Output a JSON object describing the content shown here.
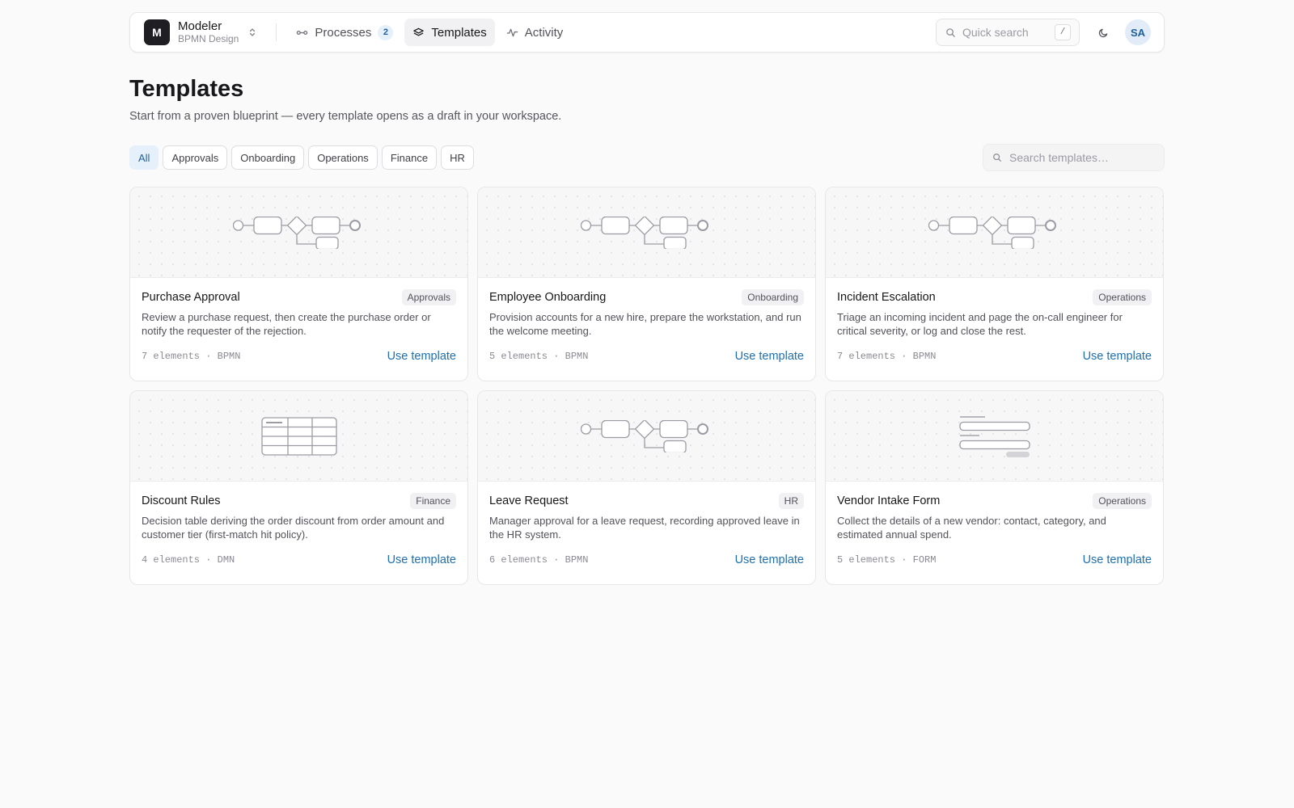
{
  "header": {
    "brand_initial": "M",
    "brand_name": "Modeler",
    "brand_sub": "BPMN Design",
    "nav": [
      {
        "label": "Processes",
        "icon": "flow-icon",
        "badge": "2"
      },
      {
        "label": "Templates",
        "icon": "layers-icon",
        "active": true
      },
      {
        "label": "Activity",
        "icon": "pulse-icon"
      }
    ],
    "search_placeholder": "Quick search",
    "search_shortcut": "/",
    "avatar": "SA"
  },
  "page": {
    "title": "Templates",
    "subtitle": "Start from a proven blueprint — every template opens as a draft in your workspace."
  },
  "filters": [
    {
      "label": "All",
      "active": true
    },
    {
      "label": "Approvals"
    },
    {
      "label": "Onboarding"
    },
    {
      "label": "Operations"
    },
    {
      "label": "Finance"
    },
    {
      "label": "HR"
    }
  ],
  "template_search_placeholder": "Search templates…",
  "templates": [
    {
      "title": "Purchase Approval",
      "tag": "Approvals",
      "preview": "bpmn",
      "description": "Review a purchase request, then create the purchase order or notify the requester of the rejection.",
      "meta": "7 elements · BPMN",
      "action": "Use template"
    },
    {
      "title": "Employee Onboarding",
      "tag": "Onboarding",
      "preview": "bpmn",
      "description": "Provision accounts for a new hire, prepare the workstation, and run the welcome meeting.",
      "meta": "5 elements · BPMN",
      "action": "Use template"
    },
    {
      "title": "Incident Escalation",
      "tag": "Operations",
      "preview": "bpmn",
      "description": "Triage an incoming incident and page the on-call engineer for critical severity, or log and close the rest.",
      "meta": "7 elements · BPMN",
      "action": "Use template"
    },
    {
      "title": "Discount Rules",
      "tag": "Finance",
      "preview": "dmn",
      "description": "Decision table deriving the order discount from order amount and customer tier (first-match hit policy).",
      "meta": "4 elements · DMN",
      "action": "Use template"
    },
    {
      "title": "Leave Request",
      "tag": "HR",
      "preview": "bpmn",
      "description": "Manager approval for a leave request, recording approved leave in the HR system.",
      "meta": "6 elements · BPMN",
      "action": "Use template"
    },
    {
      "title": "Vendor Intake Form",
      "tag": "Operations",
      "preview": "form",
      "description": "Collect the details of a new vendor: contact, category, and estimated annual spend.",
      "meta": "5 elements · FORM",
      "action": "Use template"
    }
  ]
}
